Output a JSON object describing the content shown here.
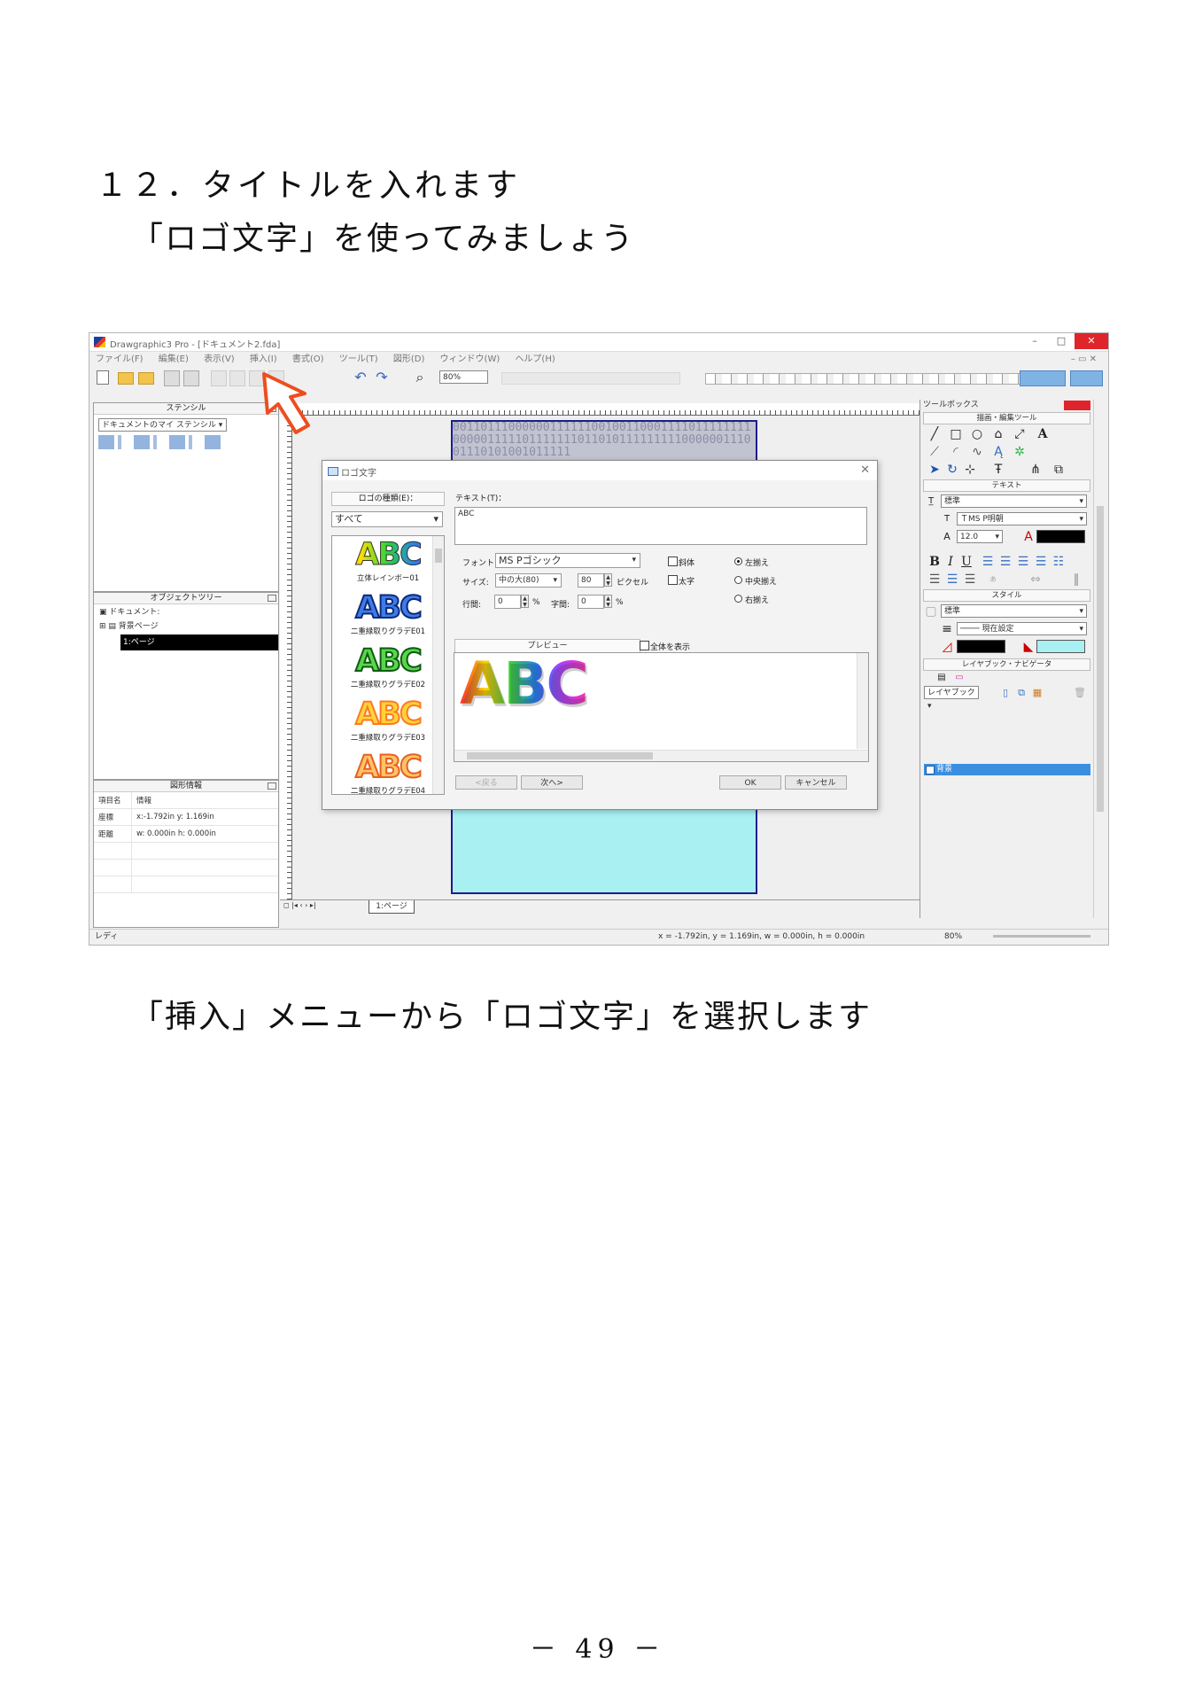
{
  "heading": "１２．タイトルを入れます",
  "subheading": "「ロゴ文字」を使ってみましょう",
  "caption": "「挿入」メニューから「ロゴ文字」を選択します",
  "page_number": "－ 49 －",
  "app": {
    "title": "Drawgraphic3 Pro - [ドキュメント2.fda]",
    "menu": [
      "ファイル(F)",
      "編集(E)",
      "表示(V)",
      "挿入(I)",
      "書式(O)",
      "ツール(T)",
      "図形(D)",
      "ウィンドウ(W)",
      "ヘルプ(H)"
    ],
    "zoom": "80%",
    "stencil": {
      "title": "ステンシル",
      "select": "ドキュメントのマイ ステンシル"
    },
    "object_tree": {
      "title": "オブジェクトツリー",
      "items": [
        "ドキュメント:",
        "背景ページ",
        "1:ページ"
      ]
    },
    "shape_info": {
      "title": "図形情報",
      "rows": [
        {
          "name": "項目名",
          "value": "情報"
        },
        {
          "name": "座標",
          "value": "x:-1.792in y: 1.169in"
        },
        {
          "name": "距離",
          "value": "w: 0.000in h: 0.000in"
        }
      ]
    },
    "page_tab": "1:ページ",
    "status": {
      "ready": "レディ",
      "coords": "x = -1.792in, y =  1.169in, w =  0.000in, h =  0.000in",
      "zoom": "80%"
    },
    "page_pattern": "0011011100000011111100100110001111011111111000001111101111111011010111111111000000111001110101001011111",
    "toolbox": {
      "title": "ツールボックス",
      "draw_section": "描画・編集ツール",
      "text_section": "テキスト",
      "text_style": "標準",
      "font": "ＴMS P明朝",
      "font_size": "12.0",
      "style_section": "スタイル",
      "style_value": "標準",
      "line_value": "現在設定",
      "layer_section": "レイヤブック・ナビゲータ",
      "layer_book": "レイヤブック",
      "layer_item": "背景",
      "fill_color": "#a8f0f2"
    }
  },
  "dialog": {
    "title": "ロゴ文字",
    "type_label": "ロゴの種類(E)：",
    "type_value": "すべて",
    "text_label": "テキスト(T)：",
    "text_value": "ABC",
    "font_label": "フォント:",
    "font_value": "MS Pゴシック",
    "size_label": "サイズ:",
    "size_value": "中の大(80)",
    "size_px": "80",
    "pixel_label": "ピクセル",
    "line_spacing_label": "行間:",
    "line_spacing_value": "0",
    "char_spacing_label": "字間:",
    "char_spacing_value": "0",
    "percent": "%",
    "italic": "斜体",
    "bold": "太字",
    "align_left": "左揃え",
    "align_center": "中央揃え",
    "align_right": "右揃え",
    "preview_label": "プレビュー",
    "show_all": "全体を表示",
    "preview_text": "ABC",
    "logos": [
      {
        "text": "ABC",
        "name": "立体レインボー01"
      },
      {
        "text": "ABC",
        "name": "二重縁取りグラデE01"
      },
      {
        "text": "ABC",
        "name": "二重縁取りグラデE02"
      },
      {
        "text": "ABC",
        "name": "二重縁取りグラデE03"
      },
      {
        "text": "ABC",
        "name": "二重縁取りグラデE04"
      }
    ],
    "back_button": "<戻る",
    "next_button": "次へ>",
    "ok_button": "OK",
    "cancel_button": "キャンセル"
  }
}
